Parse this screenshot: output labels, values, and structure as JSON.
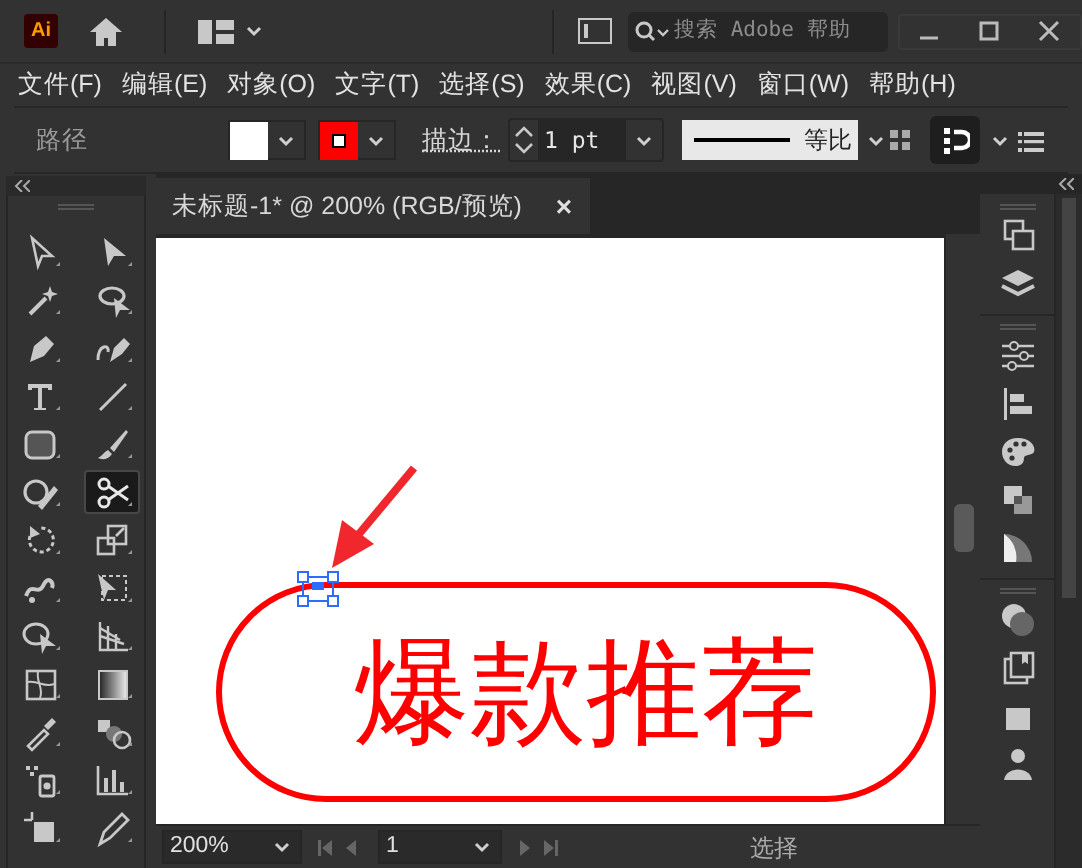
{
  "app_bar": {
    "logo": "Ai",
    "search": {
      "placeholder": "搜索 Adobe 帮助"
    }
  },
  "menu": [
    "文件(F)",
    "编辑(E)",
    "对象(O)",
    "文字(T)",
    "选择(S)",
    "效果(C)",
    "视图(V)",
    "窗口(W)",
    "帮助(H)"
  ],
  "control_bar": {
    "selection_label": "路径",
    "stroke_label": "描边：",
    "stroke_weight": "1 pt",
    "profile": "等比"
  },
  "document_tab": {
    "title": "未标题-1* @ 200% (RGB/预览)",
    "close": "×"
  },
  "tools": [
    {
      "selected": false
    },
    {
      "selected": false
    },
    {
      "selected": false
    },
    {
      "selected": false
    },
    {
      "selected": false
    },
    {
      "selected": false
    },
    {
      "selected": false
    },
    {
      "selected": false
    },
    {
      "selected": false
    },
    {
      "selected": false
    },
    {
      "selected": false
    },
    {
      "selected": true
    },
    {
      "selected": false
    },
    {
      "selected": false
    },
    {
      "selected": false
    },
    {
      "selected": false
    },
    {
      "selected": false
    },
    {
      "selected": false
    },
    {
      "selected": false
    },
    {
      "selected": false
    },
    {
      "selected": false
    },
    {
      "selected": false
    },
    {
      "selected": false
    },
    {
      "selected": false
    },
    {
      "selected": false
    },
    {
      "selected": false
    }
  ],
  "artwork": {
    "text": "爆款推荐"
  },
  "status_bar": {
    "zoom": "200%",
    "artboard": "1",
    "current_tool": "选择"
  }
}
